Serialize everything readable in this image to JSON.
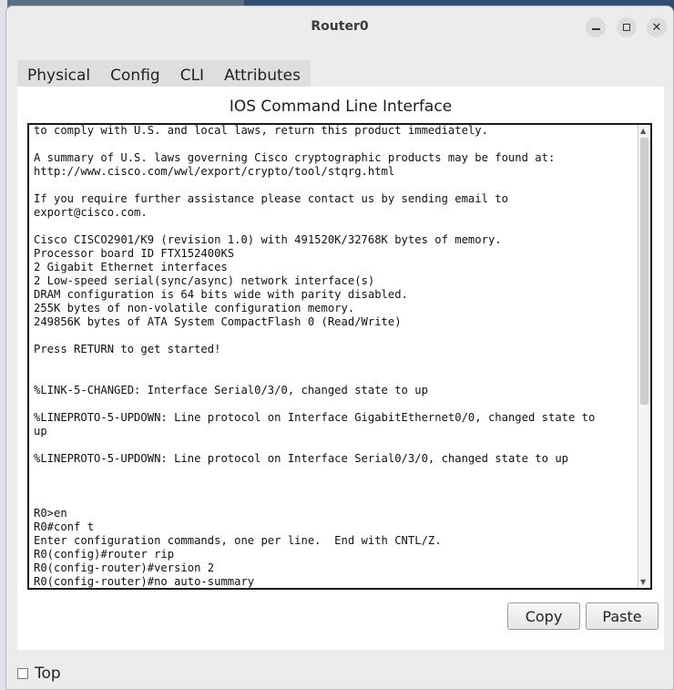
{
  "window": {
    "title": "Router0"
  },
  "tabs": [
    {
      "label": "Physical",
      "active": false
    },
    {
      "label": "Config",
      "active": false
    },
    {
      "label": "CLI",
      "active": true
    },
    {
      "label": "Attributes",
      "active": false
    }
  ],
  "panel": {
    "title": "IOS Command Line Interface"
  },
  "console": {
    "text": "to comply with U.S. and local laws, return this product immediately.\n\nA summary of U.S. laws governing Cisco cryptographic products may be found at:\nhttp://www.cisco.com/wwl/export/crypto/tool/stqrg.html\n\nIf you require further assistance please contact us by sending email to\nexport@cisco.com.\n\nCisco CISCO2901/K9 (revision 1.0) with 491520K/32768K bytes of memory.\nProcessor board ID FTX152400KS\n2 Gigabit Ethernet interfaces\n2 Low-speed serial(sync/async) network interface(s)\nDRAM configuration is 64 bits wide with parity disabled.\n255K bytes of non-volatile configuration memory.\n249856K bytes of ATA System CompactFlash 0 (Read/Write)\n\nPress RETURN to get started!\n\n\n%LINK-5-CHANGED: Interface Serial0/3/0, changed state to up\n\n%LINEPROTO-5-UPDOWN: Line protocol on Interface GigabitEthernet0/0, changed state to\nup\n\n%LINEPROTO-5-UPDOWN: Line protocol on Interface Serial0/3/0, changed state to up\n\n\n\nR0>en\nR0#conf t\nEnter configuration commands, one per line.  End with CNTL/Z.\nR0(config)#router rip\nR0(config-router)#version 2\nR0(config-router)#no auto-summary\nR0(config-router)#"
  },
  "buttons": {
    "copy": "Copy",
    "paste": "Paste"
  },
  "top_checkbox": {
    "label": "Top",
    "checked": false
  },
  "icons": {
    "minimize": "minimize-icon",
    "maximize": "maximize-icon",
    "close": "close-icon",
    "scroll_up": "arrow-up-icon",
    "scroll_down": "arrow-down-icon"
  }
}
